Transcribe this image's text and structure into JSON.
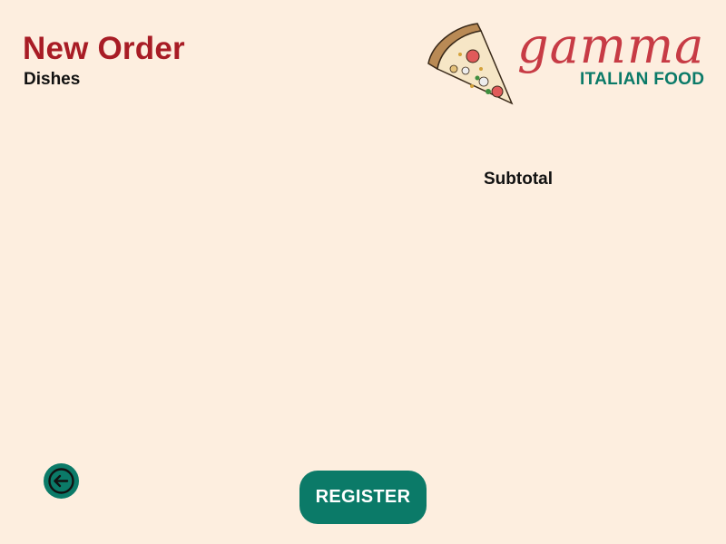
{
  "header": {
    "title": "New Order",
    "section_label": "Dishes"
  },
  "brand": {
    "name": "gamma",
    "subtitle": "ITALIAN FOOD",
    "logo_icon": "pizza-slice-icon",
    "colors": {
      "wordmark": "#C73B45",
      "subtitle": "#0B7A68"
    }
  },
  "summary": {
    "subtotal_label": "Subtotal"
  },
  "actions": {
    "register_label": "REGISTER",
    "back_icon": "arrow-left-circle-icon"
  },
  "colors": {
    "background": "#FDEEDF",
    "title": "#A81C25",
    "accent": "#0B7A68"
  }
}
